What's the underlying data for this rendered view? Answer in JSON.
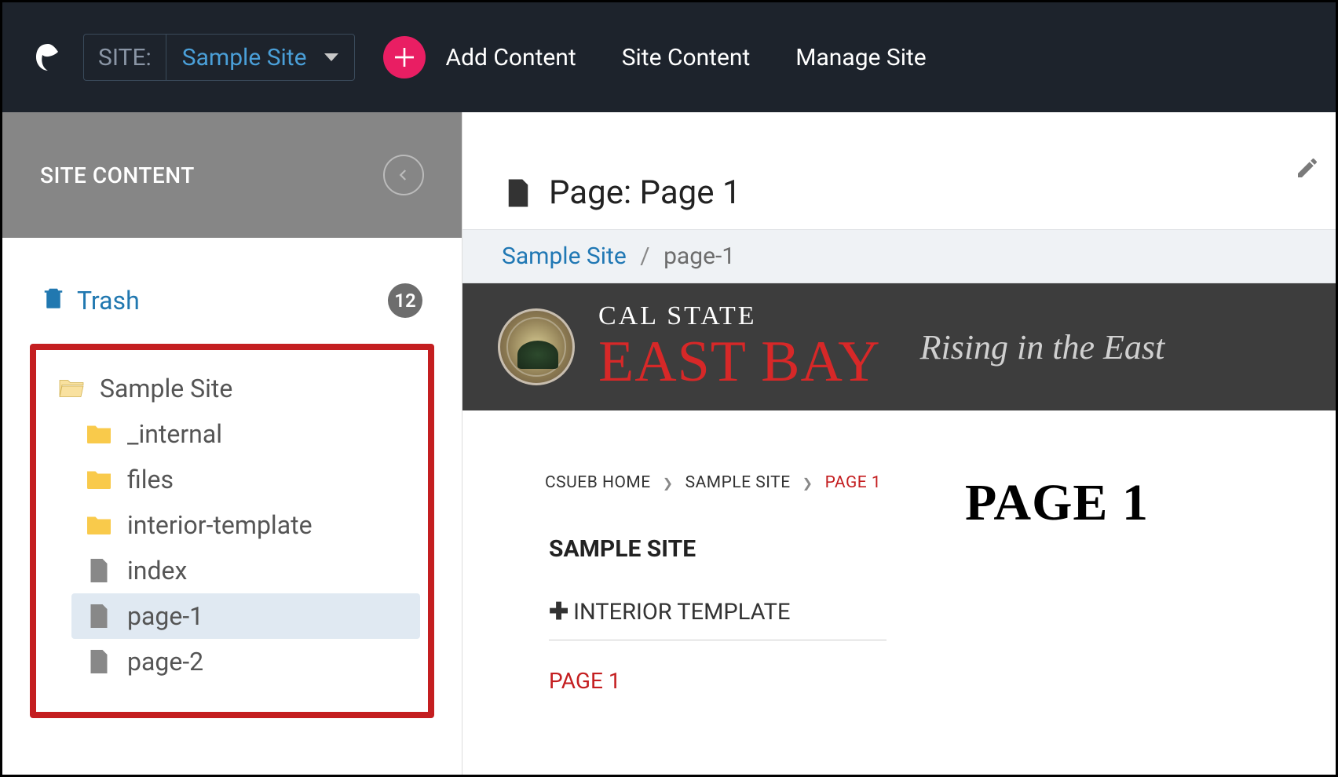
{
  "topbar": {
    "site_label": "SITE:",
    "site_value": "Sample Site",
    "add_content": "Add Content",
    "site_content": "Site Content",
    "manage_site": "Manage Site"
  },
  "sidebar": {
    "title": "SITE CONTENT",
    "trash_label": "Trash",
    "trash_count": "12",
    "root": "Sample Site",
    "items": [
      {
        "label": "_internal",
        "type": "folder"
      },
      {
        "label": "files",
        "type": "folder"
      },
      {
        "label": "interior-template",
        "type": "folder"
      },
      {
        "label": "index",
        "type": "page"
      },
      {
        "label": "page-1",
        "type": "page",
        "selected": true
      },
      {
        "label": "page-2",
        "type": "page"
      }
    ]
  },
  "content": {
    "page_title": "Page: Page 1",
    "breadcrumb": {
      "parent": "Sample Site",
      "sep": "/",
      "current": "page-1"
    },
    "banner": {
      "top": "CAL STATE",
      "main": "EAST BAY",
      "tag": "Rising in the East"
    },
    "preview": {
      "crumbs": [
        "CSUEB HOME",
        "SAMPLE SITE",
        "PAGE 1"
      ],
      "site_name": "SAMPLE SITE",
      "template": "INTERIOR TEMPLATE",
      "page_link": "PAGE 1",
      "heading": "PAGE 1"
    }
  }
}
